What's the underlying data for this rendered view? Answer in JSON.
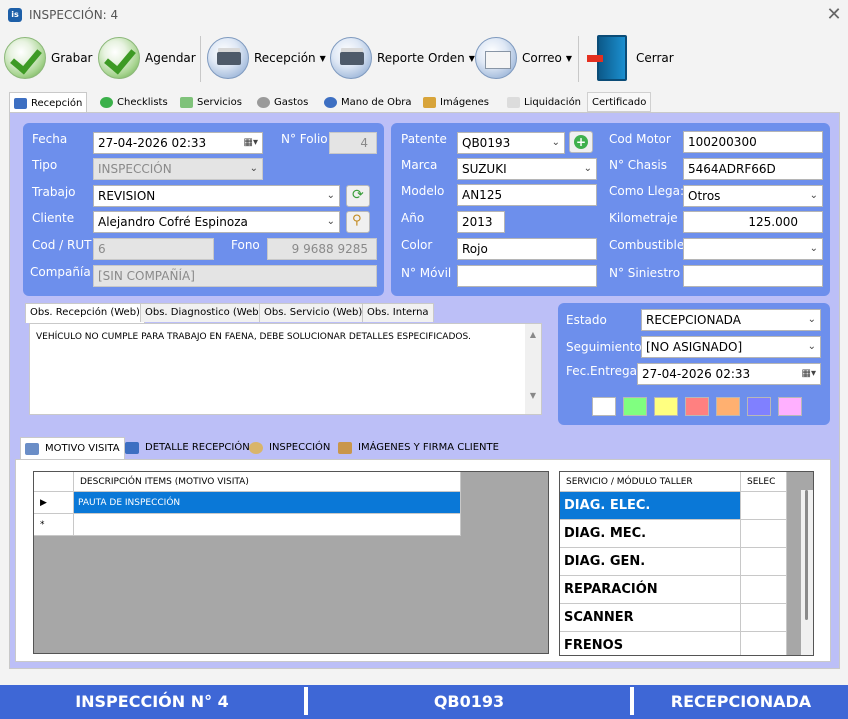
{
  "window": {
    "title": "INSPECCIÓN: 4",
    "app_icon_text": "is"
  },
  "toolbar": {
    "grabar": "Grabar",
    "agendar": "Agendar",
    "recepcion": "Recepción",
    "reporte_orden": "Reporte Orden",
    "correo": "Correo",
    "cerrar": "Cerrar"
  },
  "tabs": [
    "Recepción",
    "Checklists",
    "Servicios",
    "Gastos",
    "Mano de Obra",
    "Imágenes",
    "Liquidación",
    "Certificado"
  ],
  "form": {
    "fecha_label": "Fecha",
    "fecha": "27-04-2026  02:33",
    "folio_label": "N° Folio",
    "folio": "4",
    "tipo_label": "Tipo",
    "tipo": "INSPECCIÓN",
    "trabajo_label": "Trabajo",
    "trabajo": "REVISION",
    "cliente_label": "Cliente",
    "cliente": "Alejandro Cofré Espinoza",
    "rut_label": "Cod / RUT",
    "rut": "6",
    "fono_label": "Fono",
    "fono": "9 9688 9285",
    "compania_label": "Compañía",
    "compania": "[SIN COMPAÑÍA]"
  },
  "vehicle": {
    "patente_label": "Patente",
    "patente": "QB0193",
    "marca_label": "Marca",
    "marca": "SUZUKI",
    "modelo_label": "Modelo",
    "modelo": "AN125",
    "ano_label": "Año",
    "ano": "2013",
    "color_label": "Color",
    "color": "Rojo",
    "movil_label": "N° Móvil",
    "movil": "",
    "motor_label": "Cod Motor",
    "motor": "100200300",
    "chasis_label": "N° Chasis",
    "chasis": "5464ADRF66D",
    "llega_label": "Como Llega:",
    "llega": "Otros",
    "km_label": "Kilometraje",
    "km": "125.000",
    "combustible_label": "Combustible",
    "combustible": "",
    "siniestro_label": "N° Siniestro",
    "siniestro": ""
  },
  "obs_tabs": [
    "Obs. Recepción (Web)",
    "Obs. Diagnostico (Web)",
    "Obs. Servicio (Web)",
    "Obs. Interna"
  ],
  "obs_text": "VEHÍCULO NO CUMPLE PARA TRABAJO EN FAENA, DEBE SOLUCIONAR DETALLES ESPECIFICADOS.",
  "estado": {
    "estado_label": "Estado",
    "estado": "RECEPCIONADA",
    "seguimiento_label": "Seguimiento",
    "seguimiento": "[NO ASIGNADO]",
    "entrega_label": "Fec.Entrega",
    "entrega": "27-04-2026  02:33",
    "swatches": [
      "#ffffff",
      "#80ff80",
      "#ffff80",
      "#ff8080",
      "#ffb070",
      "#8080ff",
      "#ffb0ff"
    ]
  },
  "bottom_tabs": [
    "MOTIVO VISITA",
    "DETALLE RECEPCIÓN",
    "INSPECCIÓN",
    "IMÁGENES Y FIRMA CLIENTE"
  ],
  "motivo_grid": {
    "header": "DESCRIPCIÓN ITEMS (MOTIVO VISITA)",
    "rows": [
      "PAUTA DE INSPECCIÓN"
    ],
    "new_row_marker": "*"
  },
  "servicio_grid": {
    "header_servicio": "SERVICIO / MÓDULO TALLER",
    "header_selec": "SELEC",
    "rows": [
      "DIAG. ELEC.",
      "DIAG. MEC.",
      "DIAG. GEN.",
      "REPARACIÓN",
      "SCANNER",
      "FRENOS"
    ]
  },
  "status_bar": {
    "left": "INSPECCIÓN N° 4",
    "middle": "QB0193",
    "right": "RECEPCIONADA"
  }
}
